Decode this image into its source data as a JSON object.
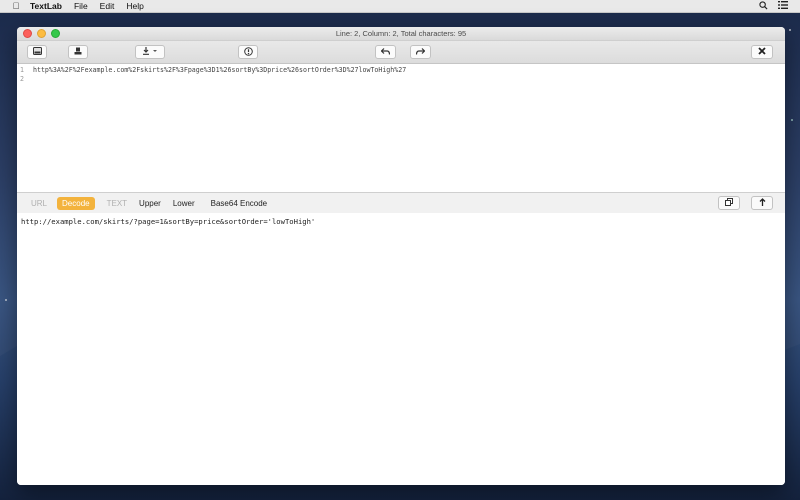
{
  "menubar": {
    "apple_icon": "apple-icon",
    "app_name": "TextLab",
    "items": [
      "File",
      "Edit",
      "Help"
    ],
    "right_icons": [
      "search-icon",
      "list-icon"
    ]
  },
  "window": {
    "status_title": "Line: 2, Column: 2, Total characters: 95"
  },
  "toolbar": {
    "buttons": [
      {
        "icon": "drive-icon"
      },
      {
        "icon": "stamp-icon"
      },
      {
        "icon": "download-dropdown-icon"
      },
      {
        "icon": "info-circle-icon"
      },
      {
        "icon": "undo-icon"
      },
      {
        "icon": "redo-icon"
      },
      {
        "icon": "close-x-icon"
      }
    ]
  },
  "editor": {
    "line_numbers": [
      "1",
      "2"
    ],
    "lines": [
      "http%3A%2F%2Fexample.com%2Fskirts%2F%3Fpage%3D1%26sortBy%3Dprice%26sortOrder%3D%27lowToHigh%27",
      ""
    ]
  },
  "actions": {
    "mode_url": "URL",
    "decode": "Decode",
    "mode_text": "TEXT",
    "upper": "Upper",
    "lower": "Lower",
    "base64": "Base64 Encode",
    "copy_icon": "copy-icon",
    "up_icon": "arrow-up-icon"
  },
  "output": {
    "text": "http://example.com/skirts/?page=1&sortBy=price&sortOrder='lowToHigh'"
  },
  "colors": {
    "accent": "#f3b33d",
    "traffic_red": "#fc605c",
    "traffic_yellow": "#fdbc40",
    "traffic_green": "#34c84a"
  }
}
